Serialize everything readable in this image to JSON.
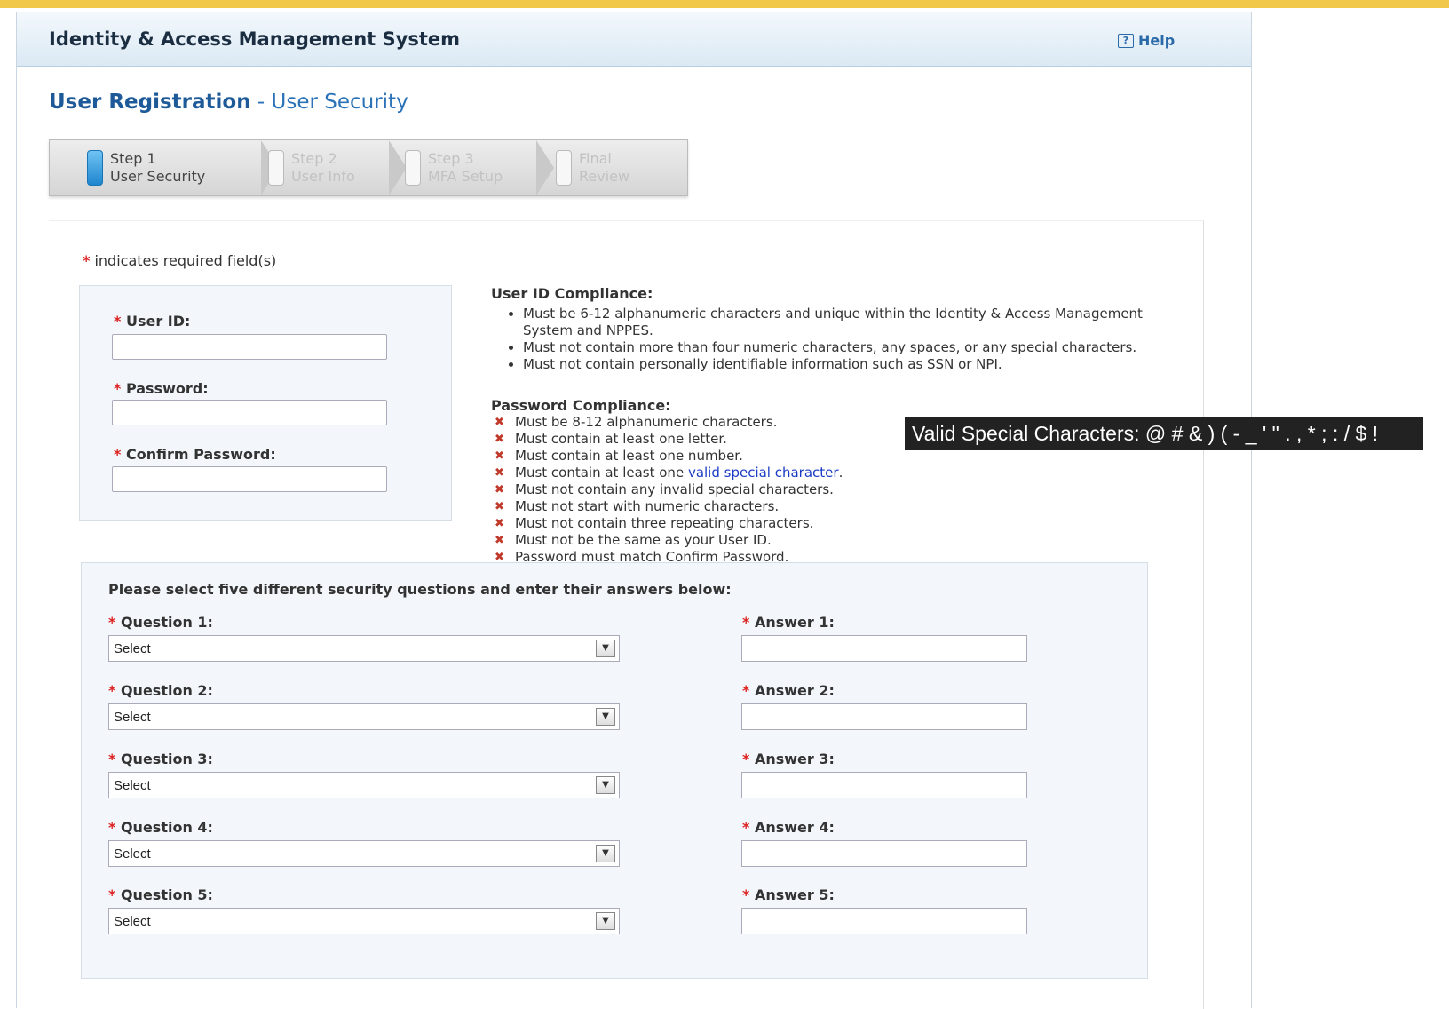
{
  "app": {
    "title": "Identity & Access Management System",
    "help_label": "Help"
  },
  "page": {
    "title_main": "User Registration",
    "title_separator": " - ",
    "title_sub": "User Security"
  },
  "steps": [
    {
      "line1": "Step 1",
      "line2": "User Security",
      "active": true
    },
    {
      "line1": "Step 2",
      "line2": "User Info",
      "active": false
    },
    {
      "line1": "Step 3",
      "line2": "MFA Setup",
      "active": false
    },
    {
      "line1": "Final",
      "line2": "Review",
      "active": false
    }
  ],
  "form": {
    "required_star": "*",
    "required_note": "indicates required field(s)",
    "user_id_label": "User ID:",
    "password_label": "Password:",
    "confirm_password_label": "Confirm Password:",
    "user_id_value": "",
    "password_value": "",
    "confirm_password_value": ""
  },
  "user_id_compliance": {
    "heading": "User ID Compliance:",
    "rules": [
      "Must be 6-12 alphanumeric characters and unique within the Identity & Access Management System and NPPES.",
      "Must not contain more than four numeric characters, any spaces, or any special characters.",
      "Must not contain personally identifiable information such as SSN or NPI."
    ]
  },
  "password_compliance": {
    "heading": "Password Compliance:",
    "status_icon": "x-icon",
    "rule_1": "Must be 8-12 alphanumeric characters.",
    "rule_2": "Must contain at least one letter.",
    "rule_3": "Must contain at least one number.",
    "rule_4_prefix": "Must contain at least one ",
    "rule_4_link": "valid special character",
    "rule_4_suffix": ".",
    "rule_5": "Must not contain any invalid special characters.",
    "rule_6": "Must not start with numeric characters.",
    "rule_7": "Must not contain three repeating characters.",
    "rule_8": "Must not be the same as your User ID.",
    "rule_9": "Password must match Confirm Password."
  },
  "tooltip": {
    "text": "Valid Special Characters: @ # & ) ( - _ ' \" . , * ; : / $ !"
  },
  "security": {
    "instruction": "Please select five different security questions and enter their answers below:",
    "questions": [
      {
        "label": "Question 1:",
        "selected": "Select",
        "answer_label": "Answer 1:",
        "answer_value": ""
      },
      {
        "label": "Question 2:",
        "selected": "Select",
        "answer_label": "Answer 2:",
        "answer_value": ""
      },
      {
        "label": "Question 3:",
        "selected": "Select",
        "answer_label": "Answer 3:",
        "answer_value": ""
      },
      {
        "label": "Question 4:",
        "selected": "Select",
        "answer_label": "Answer 4:",
        "answer_value": ""
      },
      {
        "label": "Question 5:",
        "selected": "Select",
        "answer_label": "Answer 5:",
        "answer_value": ""
      }
    ]
  },
  "colors": {
    "accent_bar": "#f2c84b",
    "link": "#2b72b8",
    "required": "#dd2222",
    "step_active": "#1f86cf"
  }
}
